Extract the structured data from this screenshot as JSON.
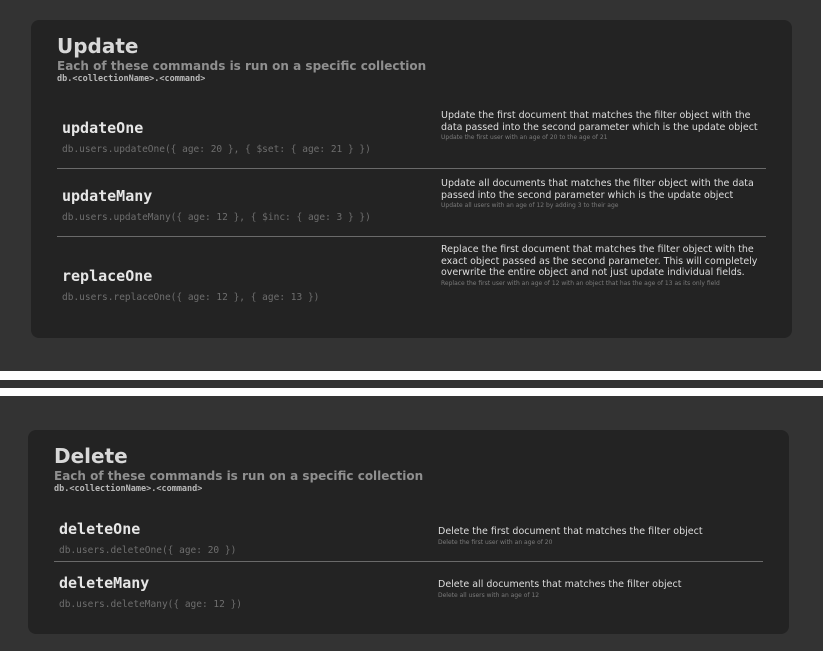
{
  "update": {
    "title": "Update",
    "subtitle": "Each of these commands is run on a specific collection",
    "path": "db.<collectionName>.<command>",
    "commands": [
      {
        "name": "updateOne",
        "example": "db.users.updateOne({ age: 20 }, { $set: { age: 21 } })",
        "description": "Update the first document that matches the filter object with the data passed into the second parameter which is the update object",
        "note": "Update the first user with an age of 20 to the age of 21"
      },
      {
        "name": "updateMany",
        "example": "db.users.updateMany({ age: 12 }, { $inc: { age: 3 } })",
        "description": "Update all documents that matches the filter object with the data passed into the second parameter which is the update object",
        "note": "Update all users with an age of 12 by adding 3 to their age"
      },
      {
        "name": "replaceOne",
        "example": "db.users.replaceOne({ age: 12 }, { age: 13 })",
        "description": "Replace the first document that matches the filter object with the exact object passed as the second parameter. This will completely overwrite the entire object and not just update individual fields.",
        "note": "Replace the first user with an age of 12 with an object that has the age of 13 as its only field"
      }
    ]
  },
  "delete": {
    "title": "Delete",
    "subtitle": "Each of these commands is run on a specific collection",
    "path": "db.<collectionName>.<command>",
    "commands": [
      {
        "name": "deleteOne",
        "example": "db.users.deleteOne({ age: 20 })",
        "description": "Delete the first document that matches the filter object",
        "note": "Delete the first user with an age of 20"
      },
      {
        "name": "deleteMany",
        "example": "db.users.deleteMany({ age: 12 })",
        "description": "Delete all documents that matches the filter object",
        "note": "Delete all users with an age of 12"
      }
    ]
  }
}
